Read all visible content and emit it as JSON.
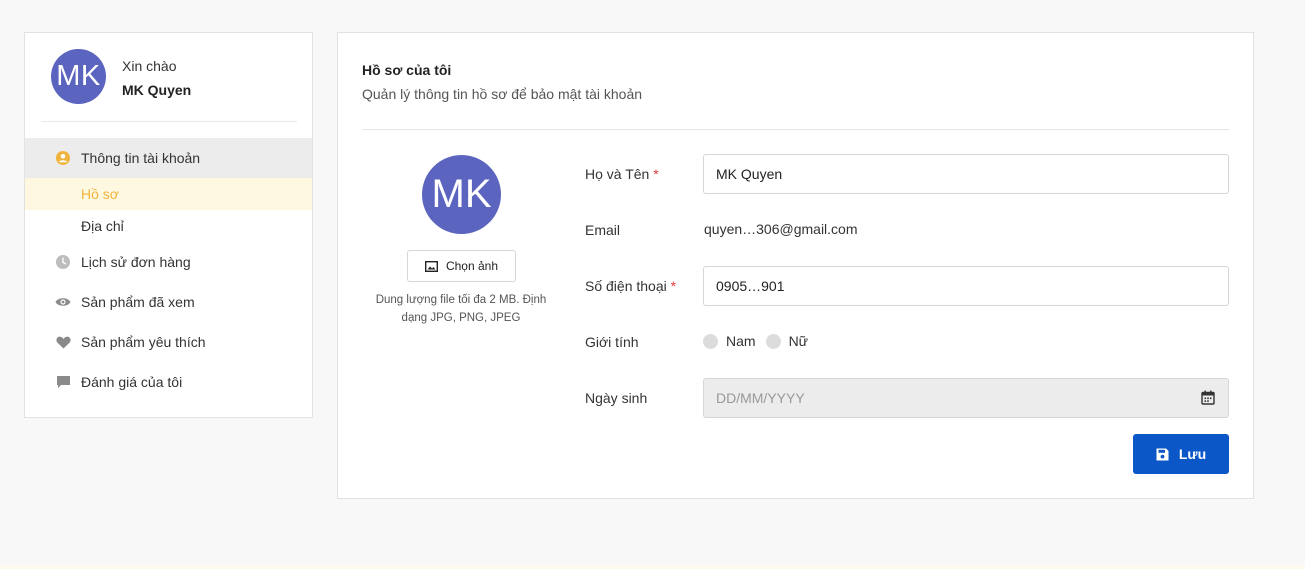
{
  "sidebar": {
    "avatar_initials": "MK",
    "greeting": "Xin chào",
    "username": "MK Quyen",
    "menu": {
      "account": "Thông tin tài khoản",
      "profile": "Hồ sơ",
      "address": "Địa chỉ",
      "orders": "Lịch sử đơn hàng",
      "viewed": "Sản phẩm đã xem",
      "favorites": "Sản phẩm yêu thích",
      "reviews": "Đánh giá của tôi"
    }
  },
  "profile": {
    "title": "Hồ sơ của tôi",
    "subtitle": "Quản lý thông tin hồ sơ để bảo mật tài khoản",
    "avatar_initials": "MK",
    "choose_image_label": "Chọn ảnh",
    "upload_hint": "Dung lượng file tối đa 2 MB. Định dạng JPG, PNG, JPEG",
    "fields": {
      "name_label": "Họ và Tên",
      "name_value": "MK Quyen",
      "email_label": "Email",
      "email_value": "quyen…306@gmail.com",
      "phone_label": "Số điện thoại",
      "phone_value": "0905…901",
      "gender_label": "Giới tính",
      "gender_male": "Nam",
      "gender_female": "Nữ",
      "dob_label": "Ngày sinh",
      "dob_placeholder": "DD/MM/YYYY",
      "required_mark": "*"
    },
    "save_label": "Lưu"
  },
  "colors": {
    "accent": "#0b57c7",
    "avatar": "#5b64be",
    "active_sub": "#f0b43c"
  }
}
